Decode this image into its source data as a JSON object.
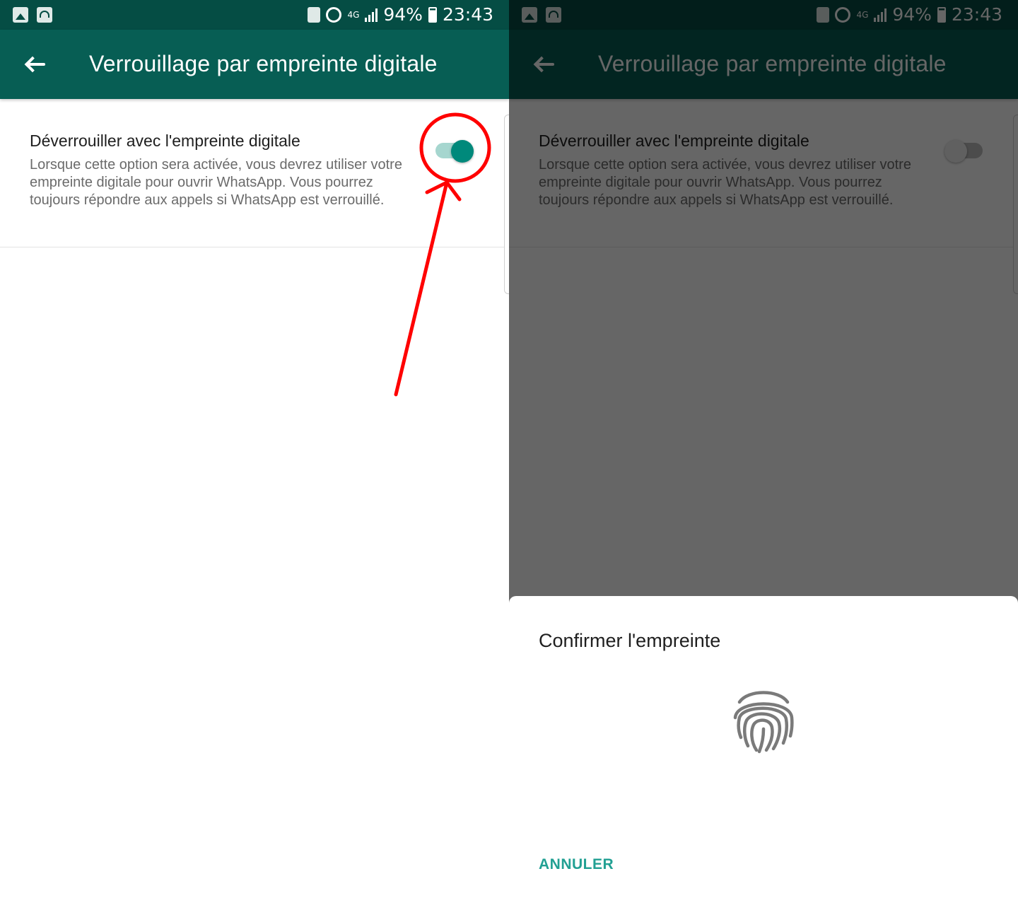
{
  "status_bar": {
    "battery": "94%",
    "time": "23:43",
    "network": "4G",
    "icons": [
      "gallery-icon",
      "wifi-hotspot-icon",
      "battery-saver-icon",
      "alarm-icon",
      "signal-icon",
      "battery-charging-icon"
    ]
  },
  "app_bar": {
    "back_icon": "arrow-back-icon",
    "title": "Verrouillage par empreinte digitale"
  },
  "setting": {
    "title": "Déverrouiller avec l'empreinte digitale",
    "description": "Lorsque cette option sera activée, vous devrez utiliser votre empreinte digitale pour ouvrir WhatsApp. Vous pourrez toujours répondre aux appels si WhatsApp est verrouillé.",
    "left_toggle_on": true,
    "right_toggle_on": false
  },
  "dialog": {
    "title": "Confirmer l'empreinte",
    "icon": "fingerprint-icon",
    "cancel_label": "ANNULER"
  },
  "colors": {
    "status_bar": "#054d44",
    "app_bar": "#075e54",
    "accent": "#00897b",
    "cancel_text": "#22a093",
    "annotation": "#ff0000"
  }
}
